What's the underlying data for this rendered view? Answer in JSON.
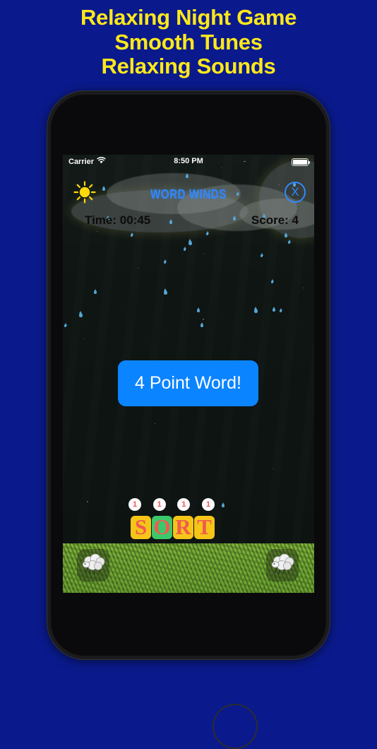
{
  "promo": {
    "line1": "Relaxing Night Game",
    "line2": "Smooth Tunes",
    "line3": "Relaxing Sounds",
    "text_color": "#ffe81a",
    "background_color": "#0a1a8c"
  },
  "device": {
    "name": "iphone-mockup",
    "frame_color": "#1b1b1d",
    "camera_icon": "camera-dot-icon",
    "speaker_icon": "earpiece-speaker-icon",
    "home_button_icon": "home-button-icon"
  },
  "status_bar": {
    "carrier": "Carrier",
    "wifi_icon": "wifi-icon",
    "time": "8:50 PM",
    "battery_icon": "battery-full-icon"
  },
  "game": {
    "title": "WORD WINDS",
    "title_color": "#2f89ff",
    "sun_icon": "sun-icon",
    "close_label": "X",
    "close_icon": "close-circle-icon",
    "hud": {
      "time_label": "Time: 00:45",
      "score_label": "Score: 4"
    },
    "cta": {
      "label": "4 Point Word!",
      "color": "#0b84ff",
      "text_color": "#ffffff"
    },
    "word": {
      "letters": [
        {
          "char": "S",
          "points": "1",
          "tile_color": "#f5c518",
          "letter_color": "#f25a4f"
        },
        {
          "char": "O",
          "points": "1",
          "tile_color": "#3cc86a",
          "letter_color": "#f25a4f"
        },
        {
          "char": "R",
          "points": "1",
          "tile_color": "#f5c518",
          "letter_color": "#f25a4f"
        },
        {
          "char": "T",
          "points": "1",
          "tile_color": "#f5c518",
          "letter_color": "#f25a4f"
        }
      ],
      "badge_bg": "#fbfbfb",
      "badge_text_color": "#f15a4a"
    },
    "field": {
      "grass_color": "#74a636",
      "sheep_left_icon": "sheep-icon",
      "sheep_right_icon": "sheep-icon"
    },
    "weather": {
      "raindrop_icon": "raindrop-icon",
      "cloud_icon": "cloud-icon"
    }
  }
}
